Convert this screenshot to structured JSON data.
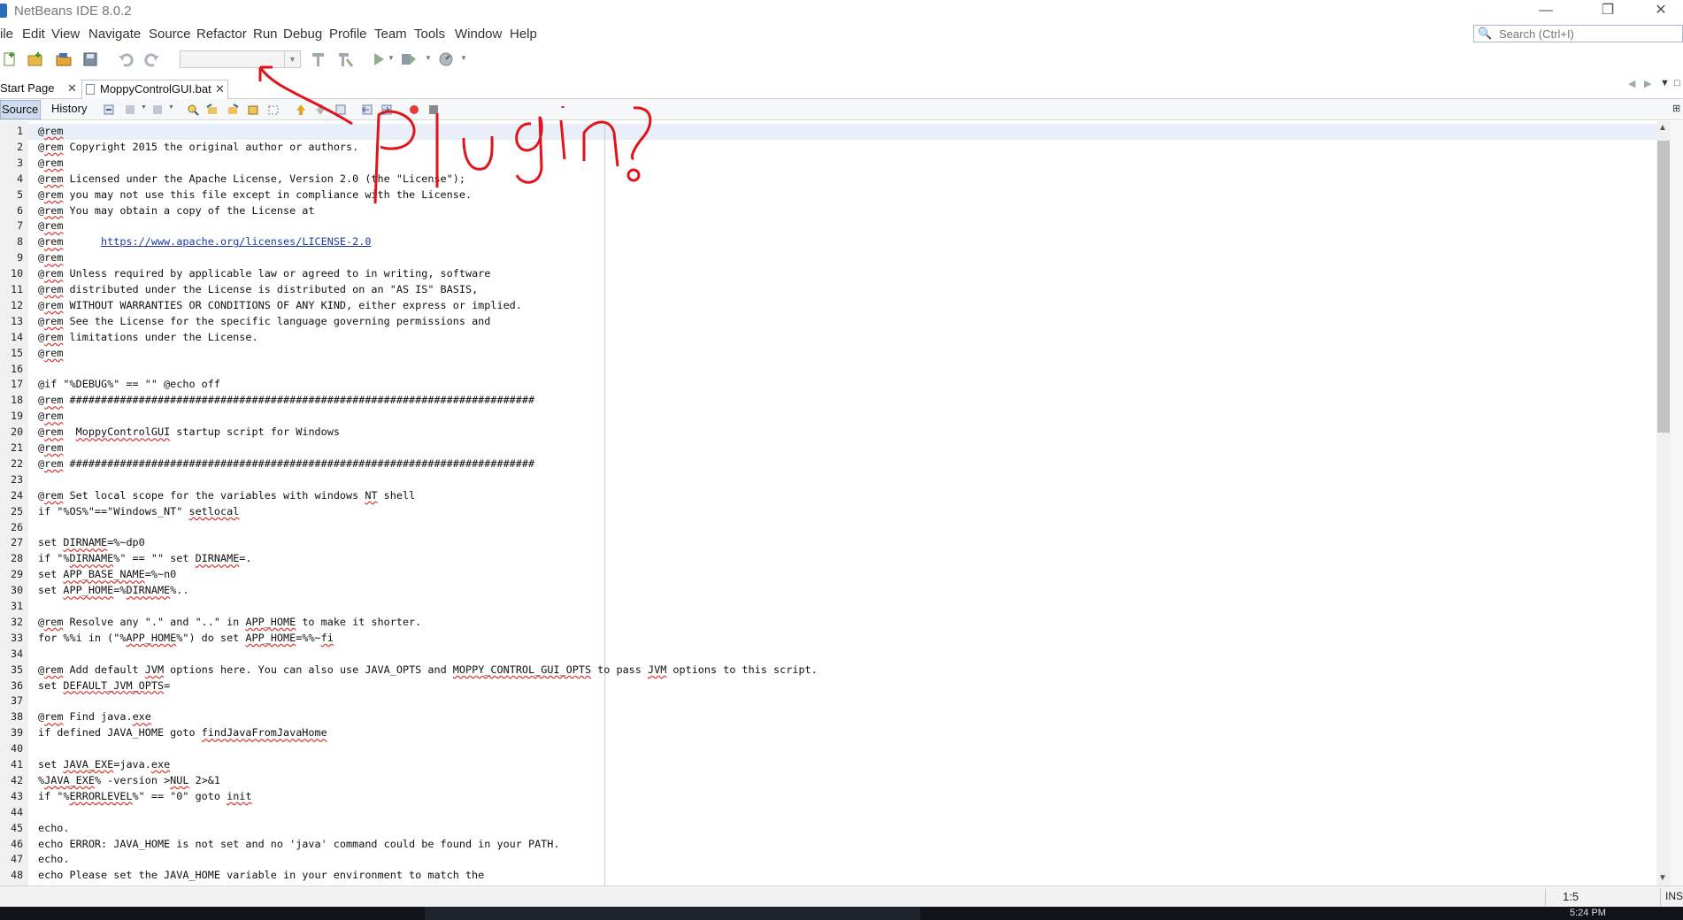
{
  "window": {
    "title": "NetBeans IDE 8.0.2",
    "minimize": "—",
    "restore": "❐",
    "close": "✕"
  },
  "menu": [
    "ile",
    "Edit",
    "View",
    "Navigate",
    "Source",
    "Refactor",
    "Run",
    "Debug",
    "Profile",
    "Team",
    "Tools",
    "Window",
    "Help"
  ],
  "search": {
    "placeholder": "Search (Ctrl+I)",
    "icon": "🔍"
  },
  "tabs": [
    {
      "label": "Start Page",
      "close": "✕"
    },
    {
      "label": "MoppyControlGUI.bat",
      "close": "✕"
    }
  ],
  "editor_tabs": {
    "source": "Source",
    "history": "History"
  },
  "annotation": {
    "text": "Plugin?"
  },
  "code_lines": [
    {
      "n": "1",
      "html": "@<span class='u'>rem</span>"
    },
    {
      "n": "2",
      "html": "@<span class='u'>rem</span> Copyright 2015 the original author or authors."
    },
    {
      "n": "3",
      "html": "@<span class='u'>rem</span>"
    },
    {
      "n": "4",
      "html": "@<span class='u'>rem</span> Licensed under the Apache License, Version 2.0 (the \"License\");"
    },
    {
      "n": "5",
      "html": "@<span class='u'>rem</span> you may not use this file except in compliance with the License."
    },
    {
      "n": "6",
      "html": "@<span class='u'>rem</span> You may obtain a copy of the License at"
    },
    {
      "n": "7",
      "html": "@<span class='u'>rem</span>"
    },
    {
      "n": "8",
      "html": "@<span class='u'>rem</span>      <span class='link'>https://www.apache.org/licenses/LICENSE-2.0</span>"
    },
    {
      "n": "9",
      "html": "@<span class='u'>rem</span>"
    },
    {
      "n": "10",
      "html": "@<span class='u'>rem</span> Unless required by applicable law or agreed to in writing, software"
    },
    {
      "n": "11",
      "html": "@<span class='u'>rem</span> distributed under the License is distributed on an \"AS IS\" BASIS,"
    },
    {
      "n": "12",
      "html": "@<span class='u'>rem</span> WITHOUT WARRANTIES OR CONDITIONS OF ANY KIND, either express or implied."
    },
    {
      "n": "13",
      "html": "@<span class='u'>rem</span> See the License for the specific language governing permissions and"
    },
    {
      "n": "14",
      "html": "@<span class='u'>rem</span> limitations under the License."
    },
    {
      "n": "15",
      "html": "@<span class='u'>rem</span>"
    },
    {
      "n": "16",
      "html": ""
    },
    {
      "n": "17",
      "html": "@if \"%DEBUG%\" == \"\" @echo off"
    },
    {
      "n": "18",
      "html": "@<span class='u'>rem</span> ##########################################################################"
    },
    {
      "n": "19",
      "html": "@<span class='u'>rem</span>"
    },
    {
      "n": "20",
      "html": "@<span class='u'>rem</span>  <span class='u'>MoppyControlGUI</span> startup script for Windows"
    },
    {
      "n": "21",
      "html": "@<span class='u'>rem</span>"
    },
    {
      "n": "22",
      "html": "@<span class='u'>rem</span> ##########################################################################"
    },
    {
      "n": "23",
      "html": ""
    },
    {
      "n": "24",
      "html": "@<span class='u'>rem</span> Set local scope for the variables with windows <span class='u'>NT</span> shell"
    },
    {
      "n": "25",
      "html": "if \"%OS%\"==\"Windows_NT\" <span class='u'>setlocal</span>"
    },
    {
      "n": "26",
      "html": ""
    },
    {
      "n": "27",
      "html": "set <span class='u'>DIRNAME</span>=%~dp0"
    },
    {
      "n": "28",
      "html": "if \"%<span class='u'>DIRNAME</span>%\" == \"\" set <span class='u'>DIRNAME</span>=."
    },
    {
      "n": "29",
      "html": "set <span class='u'>APP_BASE_NAME</span>=%~n0"
    },
    {
      "n": "30",
      "html": "set <span class='u'>APP_HOME</span>=%<span class='u'>DIRNAME</span>%.."
    },
    {
      "n": "31",
      "html": ""
    },
    {
      "n": "32",
      "html": "@<span class='u'>rem</span> Resolve any \".\" and \"..\" in <span class='u'>APP_HOME</span> to make it shorter."
    },
    {
      "n": "33",
      "html": "for %%i in (\"%<span class='u'>APP_HOME</span>%\") do set <span class='u'>APP_HOME</span>=%%~<span class='u'>fi</span>"
    },
    {
      "n": "34",
      "html": ""
    },
    {
      "n": "35",
      "html": "@<span class='u'>rem</span> Add default <span class='u'>JVM</span> options here. You can also use JAVA_OPTS and <span class='u'>MOPPY_CONTROL_GUI_OPTS</span> to pass <span class='u'>JVM</span> options to this script."
    },
    {
      "n": "36",
      "html": "set <span class='u'>DEFAULT_JVM_OPTS</span>="
    },
    {
      "n": "37",
      "html": ""
    },
    {
      "n": "38",
      "html": "@<span class='u'>rem</span> Find java.<span class='u'>exe</span>"
    },
    {
      "n": "39",
      "html": "if defined JAVA_HOME goto <span class='u'>findJavaFromJavaHome</span>"
    },
    {
      "n": "40",
      "html": ""
    },
    {
      "n": "41",
      "html": "set <span class='u'>JAVA_EXE</span>=java.<span class='u'>exe</span>"
    },
    {
      "n": "42",
      "html": "%<span class='u'>JAVA_EXE</span>% -version &gt;<span class='u'>NUL</span> 2&gt;&amp;1"
    },
    {
      "n": "43",
      "html": "if \"%<span class='u'>ERRORLEVEL</span>%\" == \"0\" goto <span class='u'>init</span>"
    },
    {
      "n": "44",
      "html": ""
    },
    {
      "n": "45",
      "html": "echo."
    },
    {
      "n": "46",
      "html": "echo ERROR: JAVA_HOME is not set and no 'java' command could be found in your PATH."
    },
    {
      "n": "47",
      "html": "echo."
    },
    {
      "n": "48",
      "html": "echo Please set the JAVA_HOME variable in your environment to match the"
    }
  ],
  "status": {
    "position": "1:5",
    "mode": "INS"
  },
  "taskbar": {
    "clock": "5:24 PM"
  }
}
